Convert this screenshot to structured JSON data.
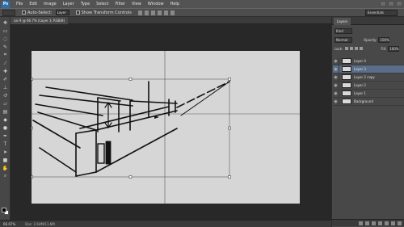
{
  "menubar": {
    "logo": "Ps",
    "items": [
      "File",
      "Edit",
      "Image",
      "Layer",
      "Type",
      "Select",
      "Filter",
      "View",
      "Window",
      "Help"
    ]
  },
  "options": {
    "auto_select_label": "Auto-Select:",
    "auto_select_value": "Layer",
    "transform_label": "Show Transform Controls",
    "workspace": "Essentials"
  },
  "document": {
    "tab_title": "sai 9 @ 66.7% (Layer 3, RGB/8)"
  },
  "status": {
    "zoom": "66.67%",
    "doc_info": "Doc: 2.64M/11.6M"
  },
  "panel": {
    "tab": "Layers",
    "kind_label": "Kind",
    "blend_mode": "Normal",
    "opacity_label": "Opacity:",
    "opacity_value": "100%",
    "lock_label": "Lock:",
    "fill_label": "Fill:",
    "fill_value": "100%",
    "layers": [
      {
        "name": "Layer 4",
        "selected": false
      },
      {
        "name": "Layer 3",
        "selected": true
      },
      {
        "name": "Layer 2 copy",
        "selected": false
      },
      {
        "name": "Layer 2",
        "selected": false
      },
      {
        "name": "Layer 1",
        "selected": false
      },
      {
        "name": "Background",
        "selected": false
      }
    ]
  },
  "icons": {
    "eye": "eye-icon",
    "move": "move-icon",
    "marquee": "marquee-icon",
    "lasso": "lasso-icon",
    "brush": "brush-icon",
    "zoom": "zoom-icon"
  },
  "colors": {
    "selection": "#5a6e8a",
    "canvas": "#d6d6d6",
    "foreground": "#000000",
    "background": "#ffffff"
  }
}
